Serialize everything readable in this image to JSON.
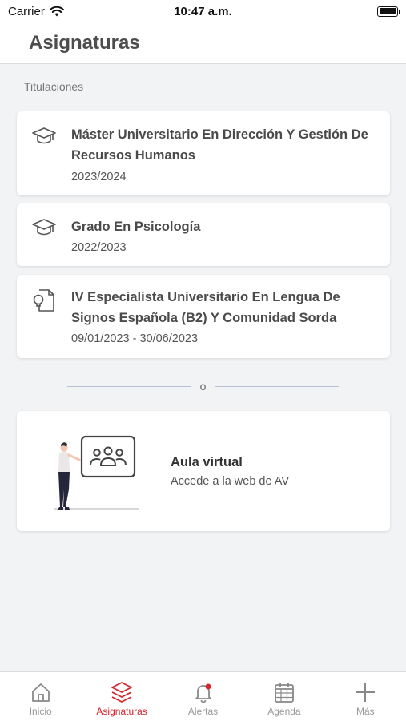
{
  "status_bar": {
    "carrier": "Carrier",
    "time": "10:47 a.m."
  },
  "header": {
    "title": "Asignaturas"
  },
  "section_label": "Titulaciones",
  "degrees": [
    {
      "title": "Máster Universitario En Dirección Y Gestión De Recursos Humanos",
      "period": "2023/2024",
      "icon": "graduation-cap-icon"
    },
    {
      "title": "Grado En Psicología",
      "period": "2022/2023",
      "icon": "graduation-cap-icon"
    },
    {
      "title": "IV Especialista Universitario En Lengua De Signos Española (B2) Y Comunidad Sorda",
      "period": "09/01/2023 - 30/06/2023",
      "icon": "document-idea-icon"
    }
  ],
  "divider_text": "o",
  "virtual_classroom": {
    "title": "Aula virtual",
    "subtitle": "Accede a la web de AV"
  },
  "tab_bar": [
    {
      "label": "Inicio",
      "icon": "home-icon",
      "active": false
    },
    {
      "label": "Asignaturas",
      "icon": "layers-icon",
      "active": true
    },
    {
      "label": "Alertas",
      "icon": "bell-icon",
      "active": false
    },
    {
      "label": "Agenda",
      "icon": "calendar-icon",
      "active": false
    },
    {
      "label": "Más",
      "icon": "plus-icon",
      "active": false
    }
  ],
  "colors": {
    "accent": "#d4242e",
    "background": "#f2f3f5",
    "card": "#ffffff"
  }
}
